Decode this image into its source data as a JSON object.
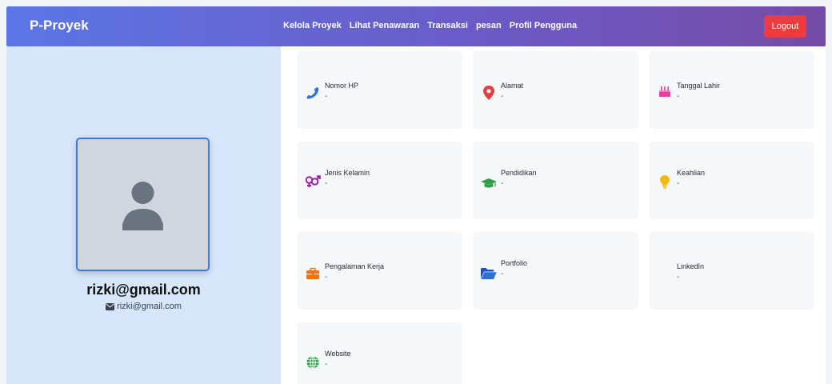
{
  "nav": {
    "brand": "P-Proyek",
    "links": [
      "Kelola Proyek",
      "Lihat Penawaran",
      "Transaksi",
      "pesan",
      "Profil Pengguna"
    ],
    "logout": "Logout"
  },
  "profile": {
    "name": "rizki@gmail.com",
    "email": "rizki@gmail.com"
  },
  "fields": [
    {
      "label": "Nomor HP",
      "value": "-",
      "icon": "phone-icon"
    },
    {
      "label": "Alamat",
      "value": "-",
      "icon": "location-pin-icon"
    },
    {
      "label": "Tanggal Lahir",
      "value": "-",
      "icon": "birthday-cake-icon"
    },
    {
      "label": "Jenis Kelamin",
      "value": "-",
      "icon": "gender-icon"
    },
    {
      "label": "Pendidikan",
      "value": "-",
      "icon": "graduation-cap-icon"
    },
    {
      "label": "Keahlian",
      "value": "-",
      "icon": "lightbulb-icon"
    },
    {
      "label": "Pengalaman Kerja",
      "value": "-",
      "icon": "briefcase-icon"
    },
    {
      "label": "Portfolio",
      "value": "-",
      "icon": "folder-open-icon"
    },
    {
      "label": "LinkedIn",
      "value": "-",
      "icon": "linkedin-icon"
    },
    {
      "label": "Website",
      "value": "-",
      "icon": "globe-icon"
    }
  ],
  "colors": {
    "navbar_start": "#5b76e6",
    "navbar_end": "#764ba8",
    "logout": "#ef3b3b",
    "sidebar": "#d7e6fb",
    "avatar_border": "#3b7bd8"
  }
}
